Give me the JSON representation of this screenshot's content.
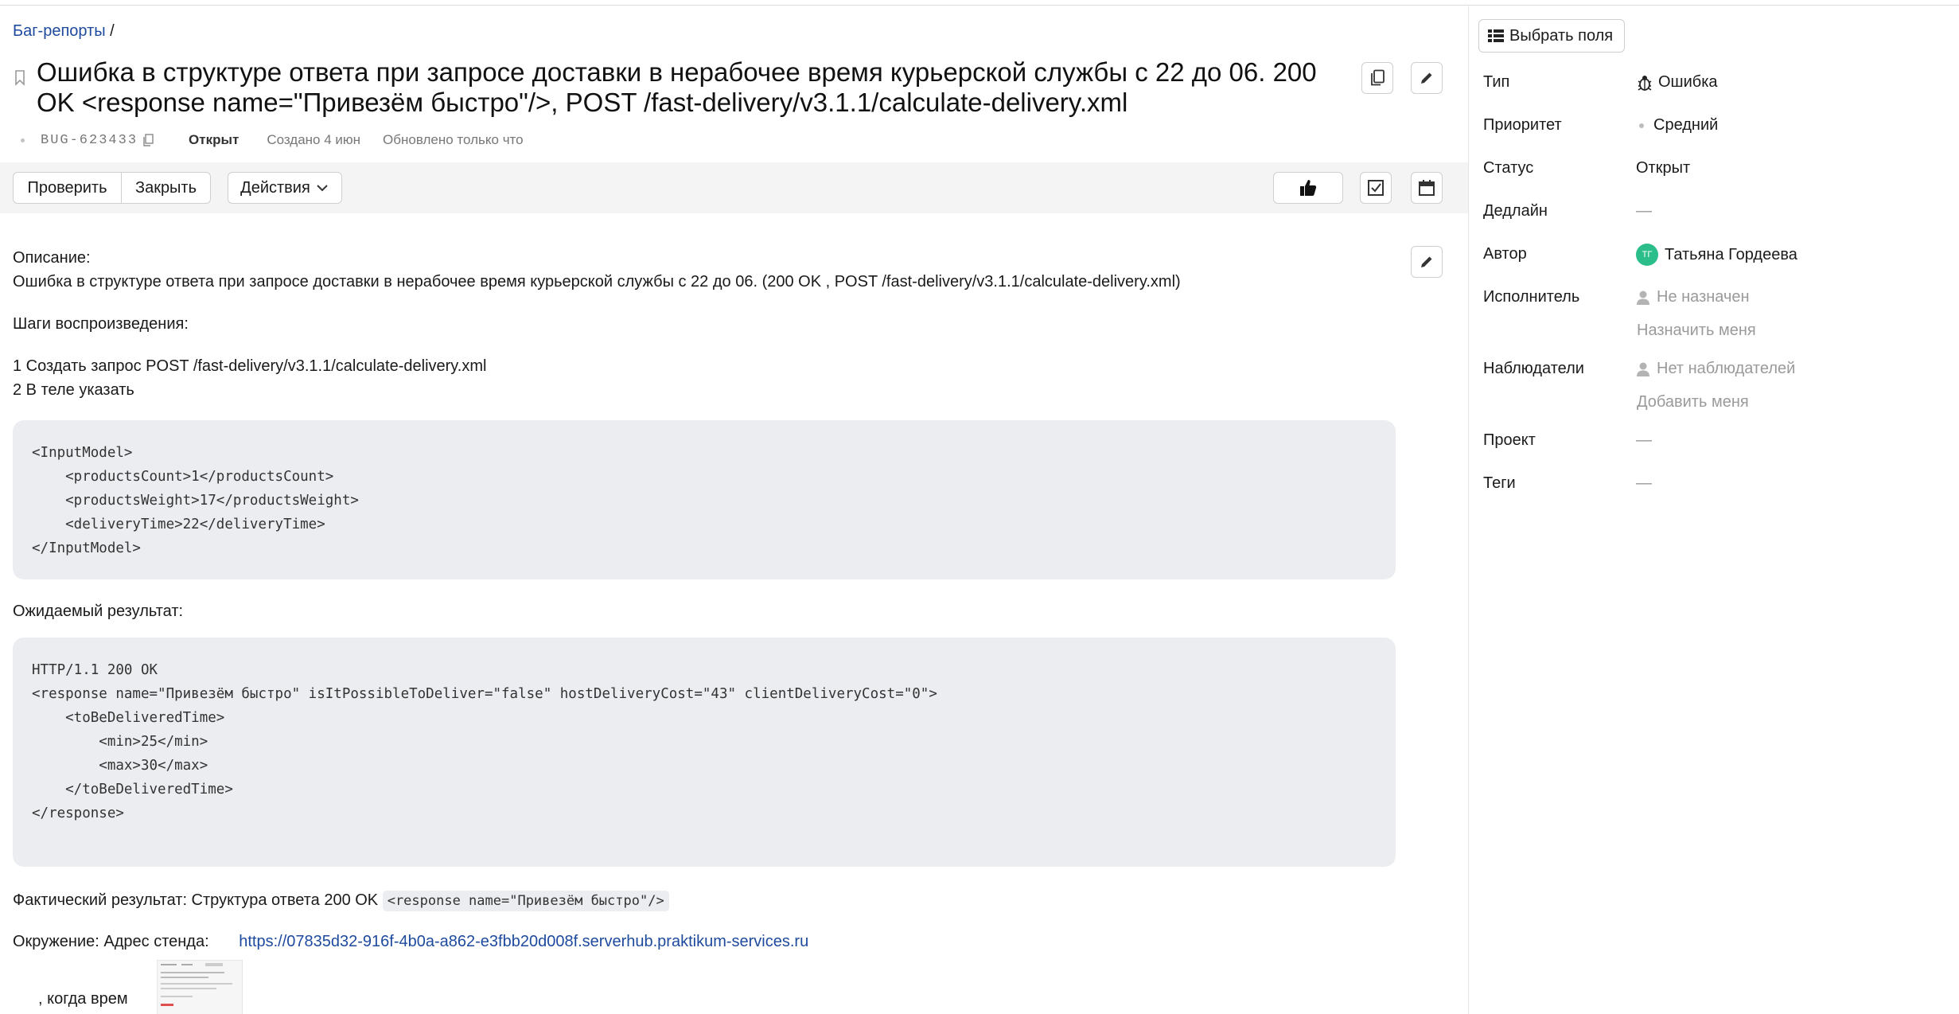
{
  "breadcrumb": {
    "link": "Баг-репорты",
    "sep": " /"
  },
  "issue": {
    "title": "Ошибка в структуре ответа при запросе доставки в нерабочее время курьерской службы с 22 до 06. 200 OK <response name=\"Привезём быстро\"/>, POST /fast-delivery/v3.1.1/calculate-delivery.xml",
    "key": "BUG-623433",
    "status": "Открыт",
    "created": "Создано 4 июн",
    "updated": "Обновлено только что"
  },
  "toolbar": {
    "check": "Проверить",
    "close": "Закрыть",
    "actions": "Действия"
  },
  "description": {
    "label": "Описание:",
    "text": "Ошибка в структуре ответа при запросе доставки в нерабочее время курьерской службы с 22 до 06. (200 OK , POST /fast-delivery/v3.1.1/calculate-delivery.xml)",
    "steps_label": "Шаги воспроизведения:",
    "step1": "1 Создать запрос POST /fast-delivery/v3.1.1/calculate-delivery.xml",
    "step2": "2 В теле указать",
    "request_code": "<InputModel>\n    <productsCount>1</productsCount>\n    <productsWeight>17</productsWeight>\n    <deliveryTime>22</deliveryTime>\n</InputModel>",
    "expected_label": "Ожидаемый результат:",
    "expected_code": "HTTP/1.1 200 OK\n<response name=\"Привезём быстро\" isItPossibleToDeliver=\"false\" hostDeliveryCost=\"43\" clientDeliveryCost=\"0\">\n    <toBeDeliveredTime>\n        <min>25</min>\n        <max>30</max>\n    </toBeDeliveredTime>\n</response>",
    "actual_label": "Фактический результат: Структура ответа 200 OK",
    "actual_code": "<response name=\"Привезём быстро\"/>",
    "env_label": "Окружение: Адрес стенда:",
    "env_url": "https://07835d32-916f-4b0a-a862-e3fbb20d008f.serverhub.praktikum-services.ru",
    "partial_text": ", когда врем"
  },
  "sidebar": {
    "choose_fields": "Выбрать поля",
    "props": {
      "type": {
        "label": "Тип",
        "value": "Ошибка"
      },
      "priority": {
        "label": "Приоритет",
        "value": "Средний"
      },
      "status": {
        "label": "Статус",
        "value": "Открыт"
      },
      "deadline": {
        "label": "Дедлайн",
        "value": "—"
      },
      "author": {
        "label": "Автор",
        "initials": "ТГ",
        "value": "Татьяна Гордеева"
      },
      "assignee": {
        "label": "Исполнитель",
        "value": "Не назначен",
        "action": "Назначить меня"
      },
      "followers": {
        "label": "Наблюдатели",
        "value": "Нет наблюдателей",
        "action": "Добавить меня"
      },
      "project": {
        "label": "Проект",
        "value": "—"
      },
      "tags": {
        "label": "Теги",
        "value": "—"
      }
    }
  },
  "colors": {
    "link": "#1e4a9e",
    "avatar": "#2bbd8a",
    "code_bg": "#ebedf0",
    "toolbar_bg": "#f4f4f4"
  }
}
